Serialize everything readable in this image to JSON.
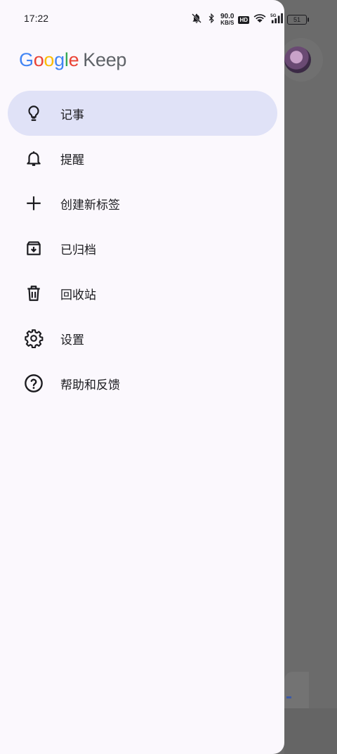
{
  "status_bar": {
    "time": "17:22",
    "speed_value": "90.0",
    "speed_unit": "KB/S",
    "hd": "HD",
    "network": "5G",
    "battery": "51"
  },
  "logo": {
    "google": [
      "G",
      "o",
      "o",
      "g",
      "l",
      "e"
    ],
    "keep": "Keep",
    "colors": [
      "#4285f4",
      "#ea4335",
      "#fbbc05",
      "#4285f4",
      "#34a853",
      "#ea4335"
    ]
  },
  "nav": {
    "items": [
      {
        "label": "记事",
        "icon": "lightbulb-icon",
        "active": true
      },
      {
        "label": "提醒",
        "icon": "bell-icon",
        "active": false
      },
      {
        "label": "创建新标签",
        "icon": "plus-icon",
        "active": false
      },
      {
        "label": "已归档",
        "icon": "archive-icon",
        "active": false
      },
      {
        "label": "回收站",
        "icon": "trash-icon",
        "active": false
      },
      {
        "label": "设置",
        "icon": "gear-icon",
        "active": false
      },
      {
        "label": "帮助和反馈",
        "icon": "help-icon",
        "active": false
      }
    ]
  },
  "colors": {
    "drawer_bg": "#fbf8fd",
    "active_bg": "#e0e2f7",
    "scrim": "#6b6b6b"
  }
}
